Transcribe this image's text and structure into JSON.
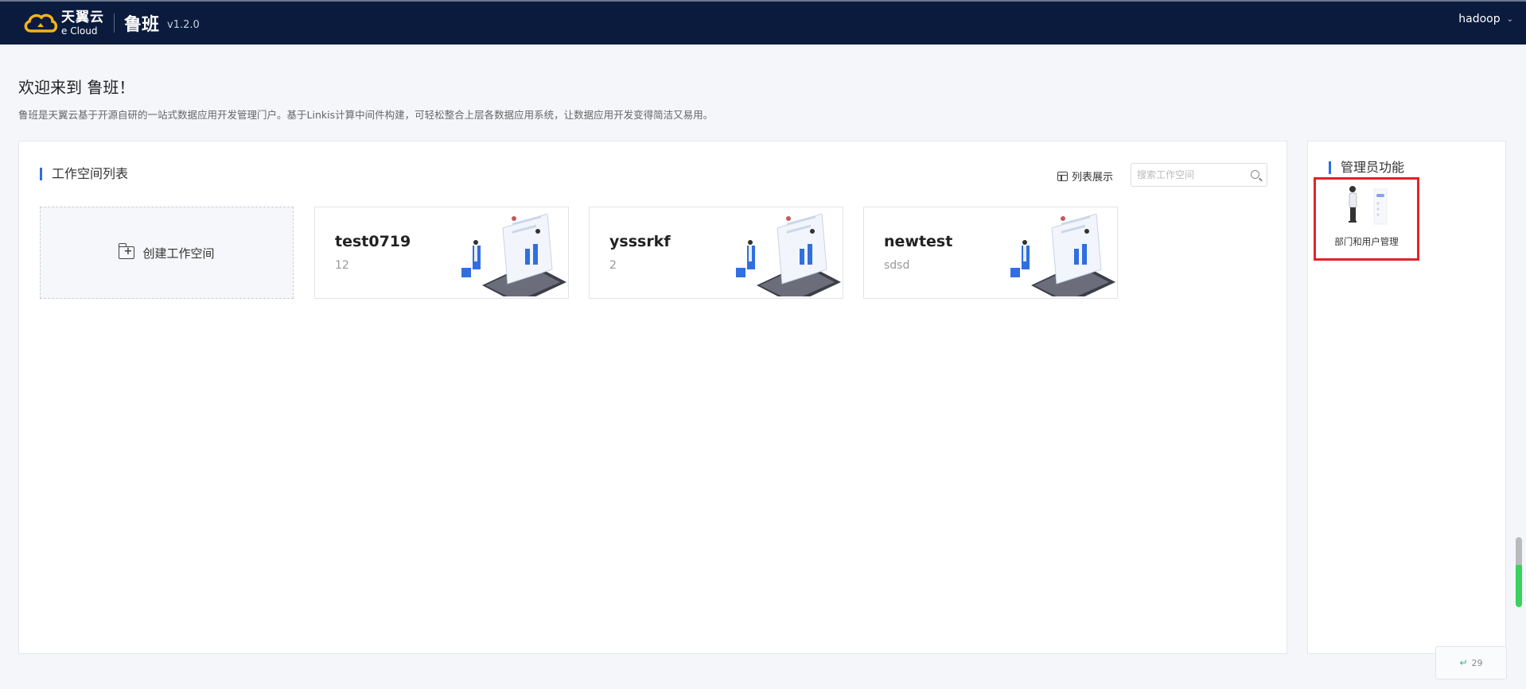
{
  "header": {
    "logo_cn": "天翼云",
    "logo_en": "e Cloud",
    "product": "鲁班",
    "version": "v1.2.0",
    "user": "hadoop"
  },
  "welcome": {
    "title": "欢迎来到 鲁班！",
    "description": "鲁班是天翼云基于开源自研的一站式数据应用开发管理门户。基于Linkis计算中间件构建，可轻松整合上层各数据应用系统，让数据应用开发变得简洁又易用。"
  },
  "workspace": {
    "section_title": "工作空间列表",
    "list_view_label": "列表展示",
    "search_placeholder": "搜索工作空间",
    "create_label": "创建工作空间",
    "cards": [
      {
        "name": "test0719",
        "desc": "12"
      },
      {
        "name": "ysssrkf",
        "desc": "2"
      },
      {
        "name": "newtest",
        "desc": "sdsd"
      }
    ]
  },
  "admin": {
    "section_title": "管理员功能",
    "items": [
      {
        "label": "部门和用户管理"
      }
    ]
  },
  "counter": {
    "value": "29"
  },
  "colors": {
    "header_bg": "#0a1b3d",
    "accent": "#2d6de6",
    "highlight_border": "#e0242a"
  }
}
